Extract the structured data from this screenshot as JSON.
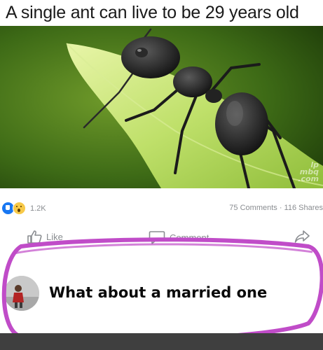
{
  "headline": "A single ant can live to be 29 years old",
  "watermark": "lp\nmbq\n.com",
  "post_stats": {
    "reaction_count": "1.2K",
    "comments_shares": "75 Comments · 116 Shares"
  },
  "actions": {
    "like_label": "Like",
    "comment_label": "Comment"
  },
  "comment": {
    "text": "What about a married one"
  },
  "colors": {
    "annotation_circle": "#c04cc8",
    "reaction_like": "#1877f2",
    "reaction_wow": "#f7c948",
    "footer": "#3f3f3f"
  },
  "icons": [
    "like-reaction-icon",
    "wow-reaction-icon",
    "thumbs-up-icon",
    "comment-bubble-icon",
    "share-arrow-icon"
  ]
}
